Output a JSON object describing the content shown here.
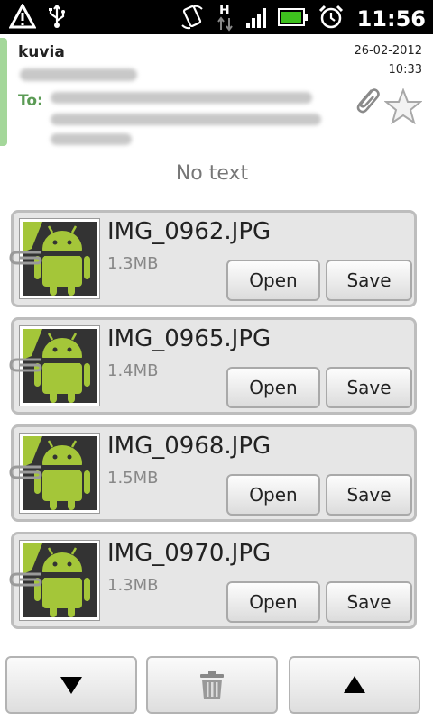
{
  "status_bar": {
    "time": "11:56",
    "icons": [
      "warning-icon",
      "usb-icon",
      "rotate-icon",
      "h-network-icon",
      "signal-icon",
      "battery-icon",
      "alarm-icon"
    ]
  },
  "message": {
    "subject": "kuvia",
    "to_label": "To:",
    "date": "26-02-2012",
    "time": "10:33",
    "body": "No text"
  },
  "attachments": [
    {
      "name": "IMG_0962.JPG",
      "size": "1.3MB",
      "open_label": "Open",
      "save_label": "Save"
    },
    {
      "name": "IMG_0965.JPG",
      "size": "1.4MB",
      "open_label": "Open",
      "save_label": "Save"
    },
    {
      "name": "IMG_0968.JPG",
      "size": "1.5MB",
      "open_label": "Open",
      "save_label": "Save"
    },
    {
      "name": "IMG_0970.JPG",
      "size": "1.3MB",
      "open_label": "Open",
      "save_label": "Save"
    }
  ],
  "colors": {
    "accent": "#a4d79a",
    "to_label": "#5b9b55",
    "android_green": "#a4c639"
  },
  "bottom_bar": {
    "buttons": [
      "down-arrow-icon",
      "trash-icon",
      "up-arrow-icon"
    ]
  }
}
